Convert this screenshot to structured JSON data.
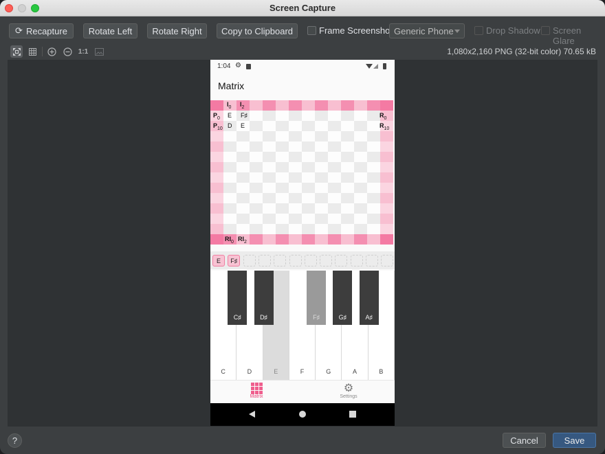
{
  "window": {
    "title": "Screen Capture"
  },
  "toolbar": {
    "recapture_label": "Recapture",
    "rotate_left_label": "Rotate Left",
    "rotate_right_label": "Rotate Right",
    "copy_label": "Copy to Clipboard",
    "frame_screenshot_label": "Frame Screenshot",
    "device_value": "Generic Phone",
    "drop_shadow_label": "Drop Shadow",
    "screen_glare_label": "Screen Glare"
  },
  "view_toolbar": {
    "actual_size_label": "1:1"
  },
  "image_info": "1,080x2,160 PNG (32-bit color) 70.65 kB",
  "phone": {
    "status_time": "1:04",
    "app_title": "Matrix",
    "matrix": {
      "top_headers": [
        {
          "base": "I",
          "sub": "0"
        },
        {
          "base": "I",
          "sub": "2"
        }
      ],
      "left_headers": [
        {
          "base": "P",
          "sub": "0"
        },
        {
          "base": "P",
          "sub": "10"
        }
      ],
      "right_headers": [
        {
          "base": "R",
          "sub": "0"
        },
        {
          "base": "R",
          "sub": "10"
        }
      ],
      "bottom_headers": [
        {
          "base": "RI",
          "sub": "0"
        },
        {
          "base": "RI",
          "sub": "2"
        }
      ],
      "cells": [
        [
          "E",
          "F♯"
        ],
        [
          "D",
          "E"
        ]
      ]
    },
    "pitch_row": [
      "E",
      "F♯"
    ],
    "piano": {
      "white_keys": [
        "C",
        "D",
        "E",
        "F",
        "G",
        "A",
        "B"
      ],
      "black_keys": [
        "C♯",
        "D♯",
        "F♯",
        "G♯",
        "A♯"
      ],
      "active_white": "E",
      "active_black": "F♯"
    },
    "bottom_nav": {
      "matrix_label": "Matrix",
      "settings_label": "Settings"
    }
  },
  "footer": {
    "help_label": "?",
    "cancel_label": "Cancel",
    "save_label": "Save"
  }
}
